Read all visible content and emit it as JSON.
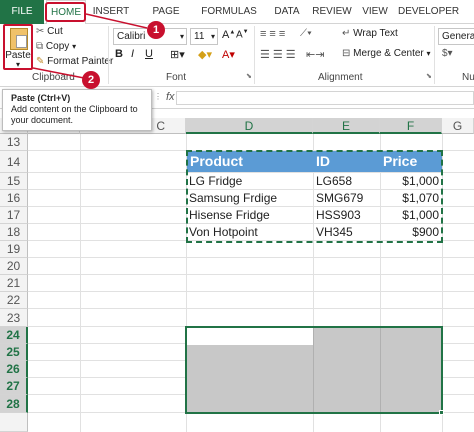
{
  "tabs": [
    "FILE",
    "HOME",
    "INSERT",
    "PAGE LAYOUT",
    "FORMULAS",
    "DATA",
    "REVIEW",
    "VIEW",
    "DEVELOPER"
  ],
  "clipboard": {
    "paste": "Paste",
    "cut": "Cut",
    "copy": "Copy",
    "format_painter": "Format Painter",
    "group": "Clipboard"
  },
  "font": {
    "name": "Calibri",
    "size": "11",
    "group": "Font",
    "bold": "B",
    "italic": "I",
    "underline": "U"
  },
  "alignment": {
    "wrap": "Wrap Text",
    "merge": "Merge & Center",
    "group": "Alignment"
  },
  "number": {
    "format": "General",
    "group": "Nu"
  },
  "tooltip": {
    "title": "Paste (Ctrl+V)",
    "body": "Add content on the Clipboard to your document."
  },
  "formula": {
    "fx": "fx"
  },
  "columns": {
    "c": "C",
    "d": "D",
    "e": "E",
    "f": "F",
    "g": "G"
  },
  "rows": [
    "13",
    "14",
    "15",
    "16",
    "17",
    "18",
    "19",
    "20",
    "21",
    "22",
    "23",
    "24",
    "25",
    "26",
    "27",
    "28"
  ],
  "table": {
    "headers": [
      "Product",
      "ID",
      "Price"
    ],
    "rows": [
      [
        "LG Fridge",
        "LG658",
        "$1,000"
      ],
      [
        "Samsung Frdige",
        "SMG679",
        "$1,070"
      ],
      [
        "Hisense Fridge",
        "HSS903",
        "$1,000"
      ],
      [
        "Von Hotpoint",
        "VH345",
        "$900"
      ]
    ]
  },
  "callouts": [
    "1",
    "2"
  ],
  "colors": {
    "excel_green": "#217346",
    "header_blue": "#5b9bd5",
    "callout_red": "#c8102e",
    "selection_gray": "#c8c8c8"
  }
}
